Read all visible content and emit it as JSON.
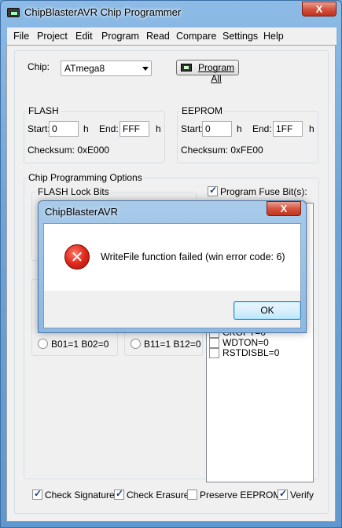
{
  "window": {
    "title": "ChipBlasterAVR Chip Programmer",
    "close_glyph": "X"
  },
  "menu": [
    "File",
    "Project",
    "Edit",
    "Program",
    "Read",
    "Compare",
    "Settings",
    "Help"
  ],
  "chip": {
    "label": "Chip:",
    "selected": "ATmega8",
    "program_all_label": "Program All"
  },
  "flash": {
    "title": "FLASH",
    "start_label": "Start:",
    "start_value": "0",
    "h1": "h",
    "end_label": "End:",
    "end_value": "FFF",
    "h2": "h",
    "checksum": "Checksum: 0xE000"
  },
  "eeprom": {
    "title": "EEPROM",
    "start_label": "Start:",
    "start_value": "0",
    "h1": "h",
    "end_label": "End:",
    "end_value": "1FF",
    "h2": "h",
    "checksum": "Checksum: 0xFE00"
  },
  "options": {
    "title": "Chip Programming Options",
    "flash_lock_title": "FLASH Lock Bits",
    "program_fuse_label": "Program Fuse Bit(s):",
    "radio_left": "B01=1 B02=0",
    "radio_right": "B11=1 B12=0",
    "fuses": [
      {
        "label": "CKOPT=0",
        "checked": false
      },
      {
        "label": "WDTON=0",
        "checked": false
      },
      {
        "label": "RSTDISBL=0",
        "checked": false
      }
    ]
  },
  "bottom_checks": [
    {
      "label": "Check Signature",
      "checked": true
    },
    {
      "label": "Check Erasure",
      "checked": true
    },
    {
      "label": "Preserve EEPROM",
      "checked": false
    },
    {
      "label": "Verify",
      "checked": true
    }
  ],
  "dialog": {
    "title": "ChipBlasterAVR",
    "close_glyph": "X",
    "icon_glyph": "✕",
    "message": "WriteFile function failed (win error code: 6)",
    "ok_label": "OK"
  }
}
